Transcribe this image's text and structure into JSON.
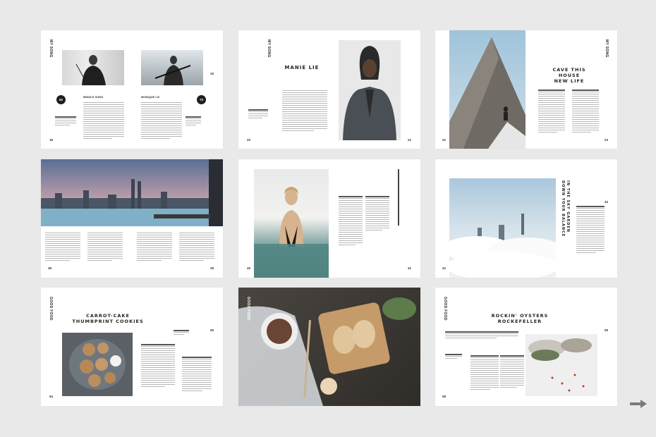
{
  "spreads": [
    {
      "label": "MY SONG",
      "left_name": "MIDDLE SONG",
      "right_name": "MONIQUE LIZ",
      "left_badge": "92",
      "right_badge": "73",
      "page_left": "18",
      "page_right": "19"
    },
    {
      "label": "MY SONG",
      "title": "MANIE LIE",
      "page_left": "20",
      "page_right": "21"
    },
    {
      "label": "MY SONG",
      "title_line1": "CAVE THIS HOUSE",
      "title_line2": "NEW LIFE",
      "page_left": "22",
      "page_right": "23"
    },
    {
      "page_left": "38",
      "page_right": "39"
    },
    {
      "page_left": "40",
      "page_right": "41"
    },
    {
      "title_line1": "DOWN YOUR BALANCE",
      "title_line2": "IN THE SKY GARDEN",
      "page_left": "42",
      "page_right": "43"
    },
    {
      "label": "GOOD FOOD",
      "title_line1": "CARROT-CAKE",
      "title_line2": "THUMBPRINT COOKIES",
      "page_left": "54",
      "page_right": "55"
    },
    {
      "label": "GOOD FOOD"
    },
    {
      "label": "GOOD FOOD",
      "title_line1": "ROCKIN' OYSTERS",
      "title_line2": "ROCKEFELLER",
      "page_left": "58",
      "page_right": "59"
    }
  ],
  "navigation": {
    "next_icon": "arrow-right-icon"
  }
}
